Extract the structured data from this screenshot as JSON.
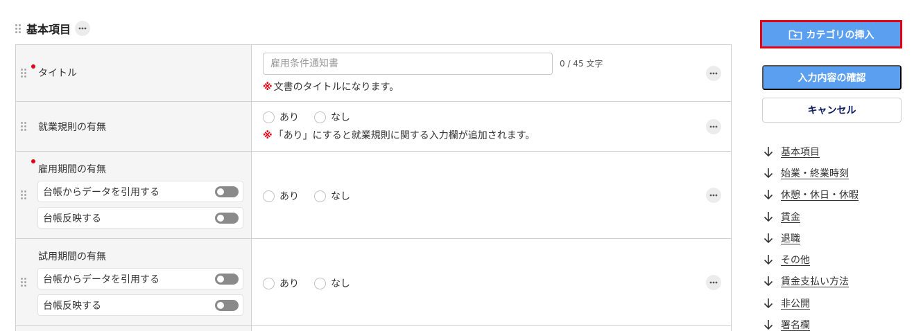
{
  "section": {
    "title": "基本項目"
  },
  "rows": {
    "title": {
      "label": "タイトル",
      "input_value": "",
      "input_placeholder": "雇用条件通知書",
      "counter": "0 / 45 文字",
      "note_mark": "※",
      "note_text": "文書のタイトルになります。"
    },
    "work_rules": {
      "label": "就業規則の有無",
      "option_yes": "あり",
      "option_no": "なし",
      "note_mark": "※",
      "note_text": "「あり」にすると就業規則に関する入力欄が追加されます。"
    },
    "employment_period": {
      "label": "雇用期間の有無",
      "toggle_import": "台帳からデータを引用する",
      "toggle_reflect": "台帳反映する",
      "option_yes": "あり",
      "option_no": "なし"
    },
    "trial_period": {
      "label": "試用期間の有無",
      "toggle_import": "台帳からデータを引用する",
      "toggle_reflect": "台帳反映する",
      "option_yes": "あり",
      "option_no": "なし"
    }
  },
  "sidebar": {
    "insert_category": "カテゴリの挿入",
    "confirm": "入力内容の確認",
    "cancel": "キャンセル",
    "nav": [
      "基本項目",
      "始業・終業時刻",
      "休憩・休日・休暇",
      "賃金",
      "退職",
      "その他",
      "賃金支払い方法",
      "非公開",
      "署名欄"
    ]
  },
  "colors": {
    "primary": "#5b9ff0",
    "required_dot": "#e60012",
    "highlight_border": "#e60012",
    "cancel_text": "#0a1a5c"
  },
  "icons": {
    "drag": "drag-handle-icon",
    "more": "more-horizontal-icon",
    "folder_add": "folder-plus-icon",
    "arrow_down": "arrow-down-icon"
  }
}
